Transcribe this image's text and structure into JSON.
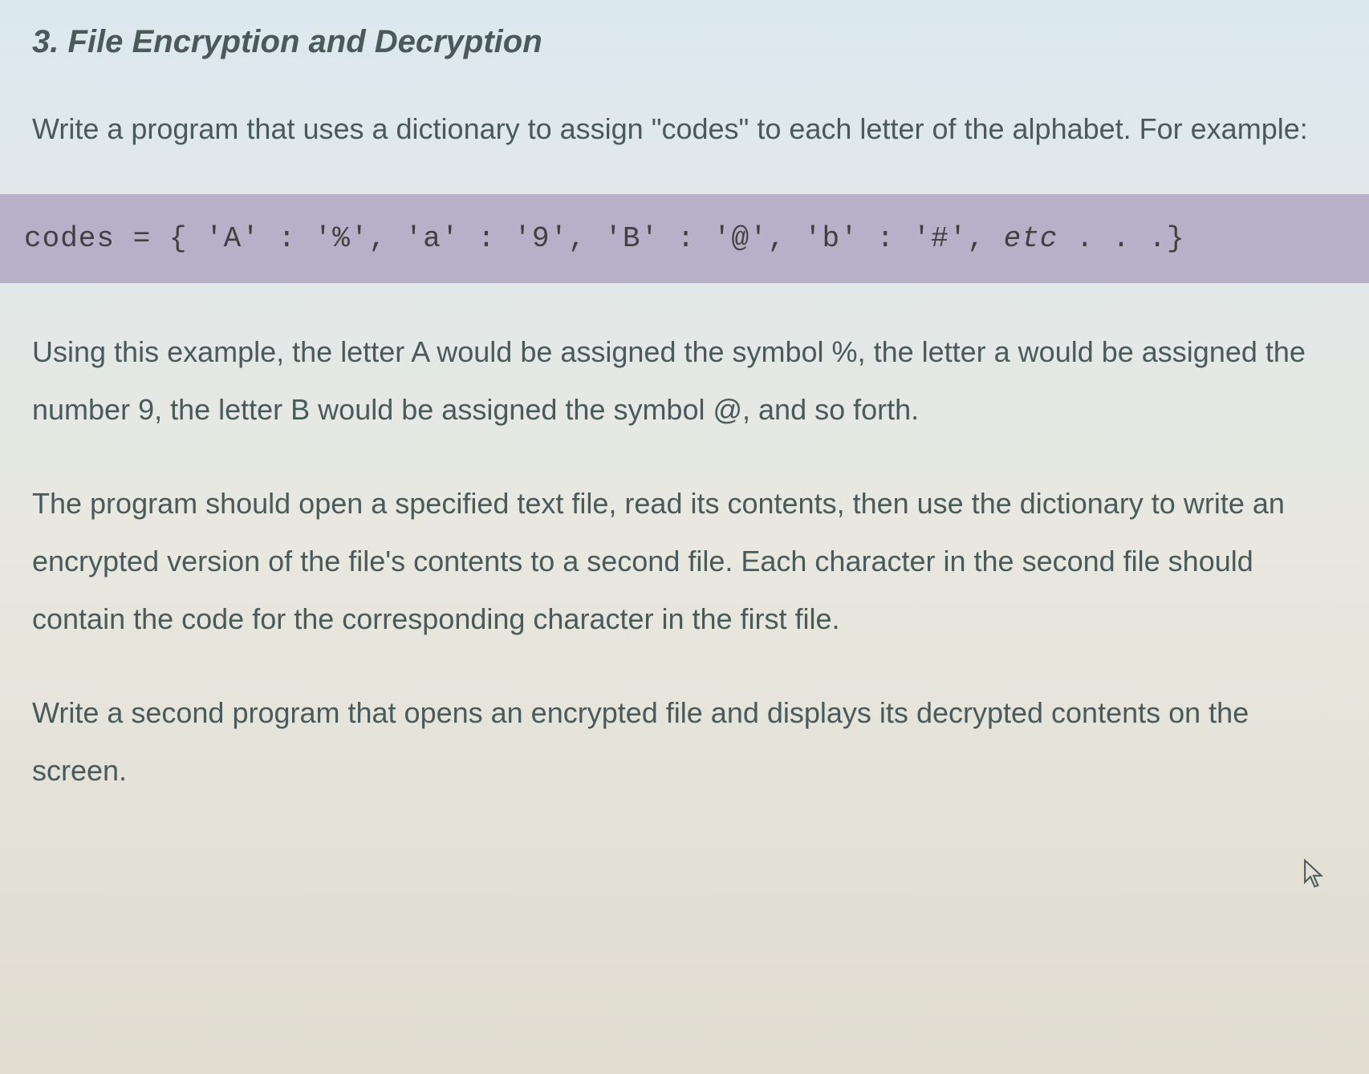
{
  "heading": "3. File Encryption and Decryption",
  "paragraph1": "Write a program that uses a dictionary to assign \"codes\" to each letter of the alphabet. For example:",
  "code_block": {
    "prefix": "codes = { 'A' : '%', 'a' : '9', 'B' : '@', 'b' : '#', ",
    "etc": "etc",
    "suffix": " . . .}"
  },
  "paragraph2": "Using this example, the letter A would be assigned the symbol %, the letter a would be assigned the number 9, the letter B would be assigned the symbol @, and so forth.",
  "paragraph3": "The program should open a specified text file, read its contents, then use the dictionary to write an encrypted version of the file's contents to a second file. Each character in the second file should contain the code for the corresponding character in the first file.",
  "paragraph4": "Write a second program that opens an encrypted file and displays its decrypted contents on the screen."
}
